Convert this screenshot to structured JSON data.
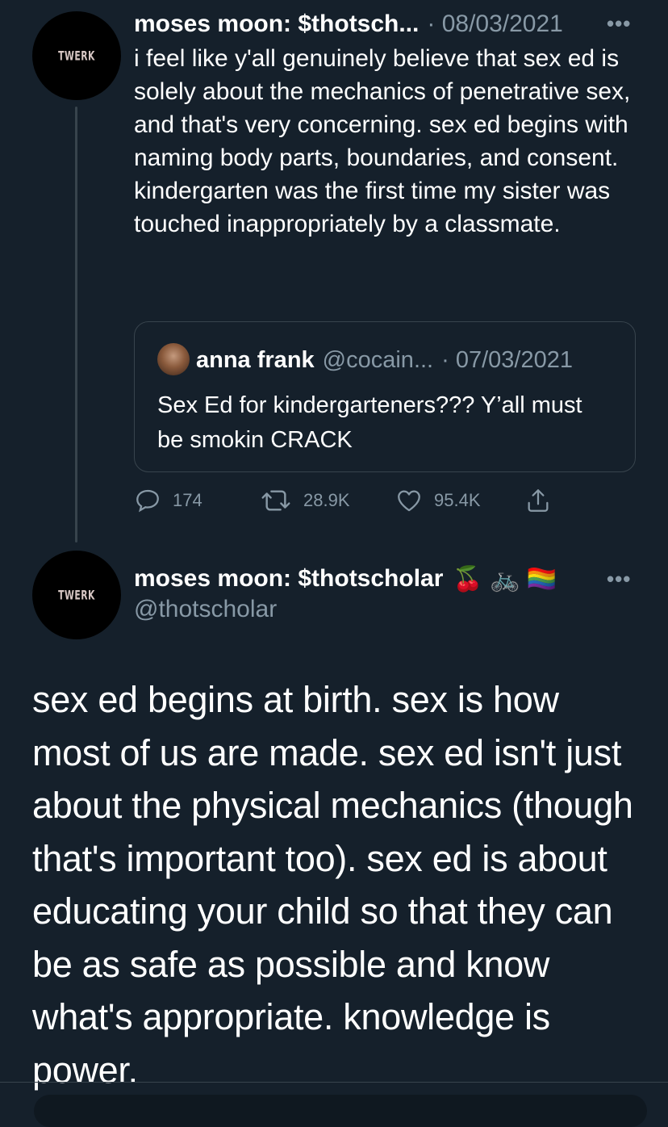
{
  "reply_tweet": {
    "avatar_text": "TWERK",
    "display_name": "moses moon: $thotsch...",
    "date": "· 08/03/2021",
    "text": "i feel like y'all genuinely believe that sex ed is solely about the mechanics of penetrative sex, and that's very concerning. sex ed begins with naming body parts, boundaries, and consent. kindergarten was the first time my sister was touched inappropriately by a classmate.",
    "quoted": {
      "display_name": "anna frank",
      "handle": "@cocain...",
      "date": "· 07/03/2021",
      "text": "Sex Ed for kindergarteners??? Y’all must be smokin CRACK"
    },
    "actions": {
      "replies": "174",
      "retweets": "28.9K",
      "likes": "95.4K"
    },
    "icons": [
      "reply-icon",
      "retweet-icon",
      "like-icon",
      "share-icon",
      "more-icon"
    ]
  },
  "main_tweet": {
    "avatar_text": "TWERK",
    "display_name": "moses moon: $thotscholar",
    "name_emojis": "🍒 🚲 🏳️‍🌈",
    "handle": "@thotscholar",
    "text": "sex ed begins at birth. sex is how most of us are made. sex ed isn't just about the physical mechanics (though that's important too). sex ed is about educating your child so that they can be as safe as possible and know what's appropriate. knowledge is power."
  },
  "colors": {
    "background": "#15202b",
    "text": "#ffffff",
    "muted": "#8899a6",
    "border": "#38444d"
  }
}
